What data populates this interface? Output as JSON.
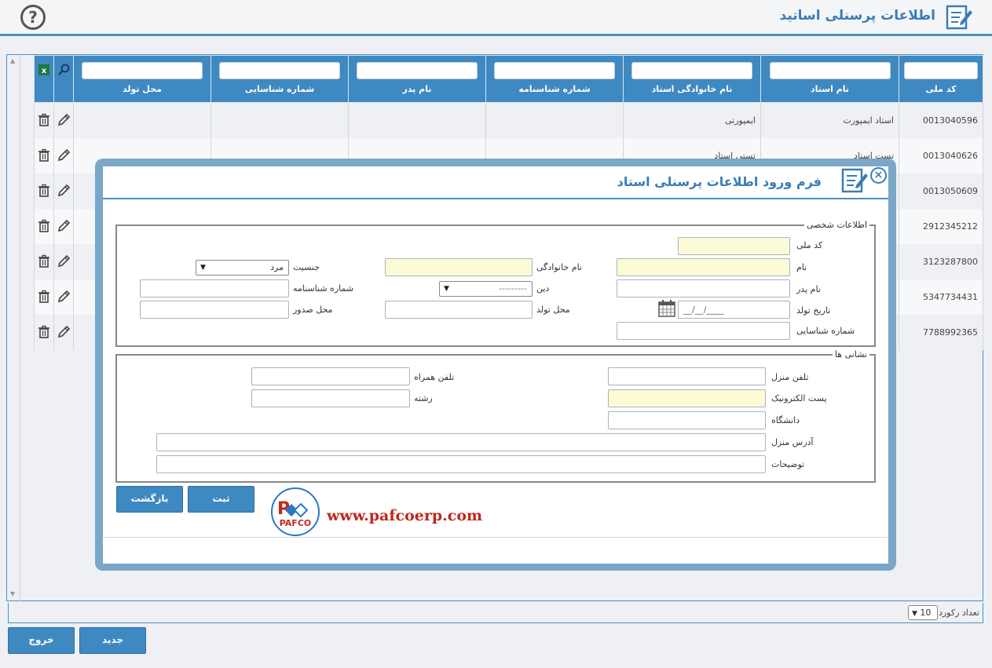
{
  "header": {
    "title": "اطلاعات پرسنلی اساتید",
    "title_icon": "form-edit-icon",
    "help_icon": "help-icon",
    "help_glyph": "?"
  },
  "grid": {
    "columns": [
      "کد ملی",
      "نام استاد",
      "نام خانوادگی استاد",
      "شماره شناسنامه",
      "نام پدر",
      "شماره شناسایی",
      "محل تولد"
    ],
    "tool_icons": [
      "search-icon",
      "excel-export-icon"
    ],
    "rows": [
      {
        "national_code": "0013040596",
        "first_name": "استاد ایمپورت",
        "last_name": "ایمپورتی"
      },
      {
        "national_code": "0013040626",
        "first_name": "تست استاد",
        "last_name": "تستی استاد"
      },
      {
        "national_code": "0013050609",
        "first_name": "",
        "last_name": ""
      },
      {
        "national_code": "2912345212",
        "first_name": "",
        "last_name": ""
      },
      {
        "national_code": "3123287800",
        "first_name": "",
        "last_name": ""
      },
      {
        "national_code": "5347734431",
        "first_name": "",
        "last_name": ""
      },
      {
        "national_code": "7788992365",
        "first_name": "",
        "last_name": ""
      }
    ],
    "row_icons": {
      "edit": "pencil-icon",
      "delete": "trash-icon"
    }
  },
  "footer": {
    "record_count_label": "تعداد رکورد :",
    "record_count_value": "10",
    "new_label": "جدید",
    "exit_label": "خروج"
  },
  "modal": {
    "title": "فرم ورود اطلاعات پرسنلی استاد",
    "close_glyph": "×",
    "personal_legend": "اطلاعات شخصی",
    "labels": {
      "national_code": "کد ملی",
      "first_name": "نام",
      "last_name": "نام خانوادگی",
      "gender": "جنسیت",
      "father_name": "نام پدر",
      "religion": "دین",
      "birth_cert_no": "شماره شناسنامه",
      "birth_date": "تاریخ تولد",
      "birth_place": "محل تولد",
      "issue_place": "محل صدور",
      "id_no": "شماره شناسایی"
    },
    "values": {
      "gender": "مرد",
      "religion": "---------",
      "birth_date_mask": "__/__/____"
    },
    "address_legend": "نشانی ها",
    "address_labels": {
      "home_phone": "تلفن منزل",
      "mobile": "تلفن همراه",
      "email": "پست الکترونیک",
      "field": "رشته",
      "university": "دانشگاه",
      "home_address": "آدرس منزل",
      "notes": "توضیحات"
    },
    "submit_label": "ثبت",
    "back_label": "بازگشت",
    "website": "www.pafcoerp.com",
    "logo_text": "PAFCO"
  }
}
